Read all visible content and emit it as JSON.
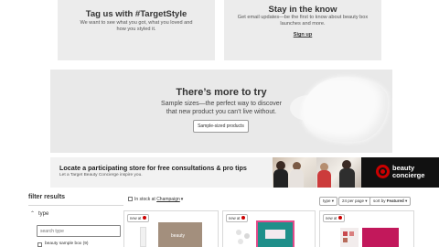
{
  "tiles": {
    "left": {
      "title": "Tag us with #TargetStyle",
      "body": "We want to see what you got, what you loved and how you styled it."
    },
    "right": {
      "title": "Stay in the know",
      "body": "Get email updates—be the first to know about beauty box launches and more.",
      "link": "Sign up"
    }
  },
  "promo": {
    "title": "There’s more to try",
    "body_line1": "Sample sizes—the perfect way to discover",
    "body_line2": "that new product you can’t live without.",
    "button": "Sample-sized products"
  },
  "locate": {
    "title": "Locate a participating store for free consultations & pro tips",
    "subtitle": "Let a Target Beauty Concierge inspire you.",
    "brand_line1": "beauty",
    "brand_line2": "concierge"
  },
  "filters": {
    "header": "filter results",
    "group_label": "type",
    "search_placeholder": "search type",
    "first_option": "beauty sample box (9)"
  },
  "results": {
    "in_stock_prefix": "In stock at ",
    "store": "Champaign",
    "type_select": "type",
    "per_page_select": "24 per page",
    "sort_prefix": "sort by ",
    "sort_value": "Featured",
    "cards": [
      {
        "tag": "new at",
        "brand": "beauty"
      },
      {
        "tag": "new at",
        "brand": ""
      },
      {
        "tag": "new at",
        "brand": ""
      }
    ]
  },
  "colors": {
    "accent": "#cc0000",
    "tile_bg": "#ececec",
    "concierge_bg": "#111111"
  }
}
